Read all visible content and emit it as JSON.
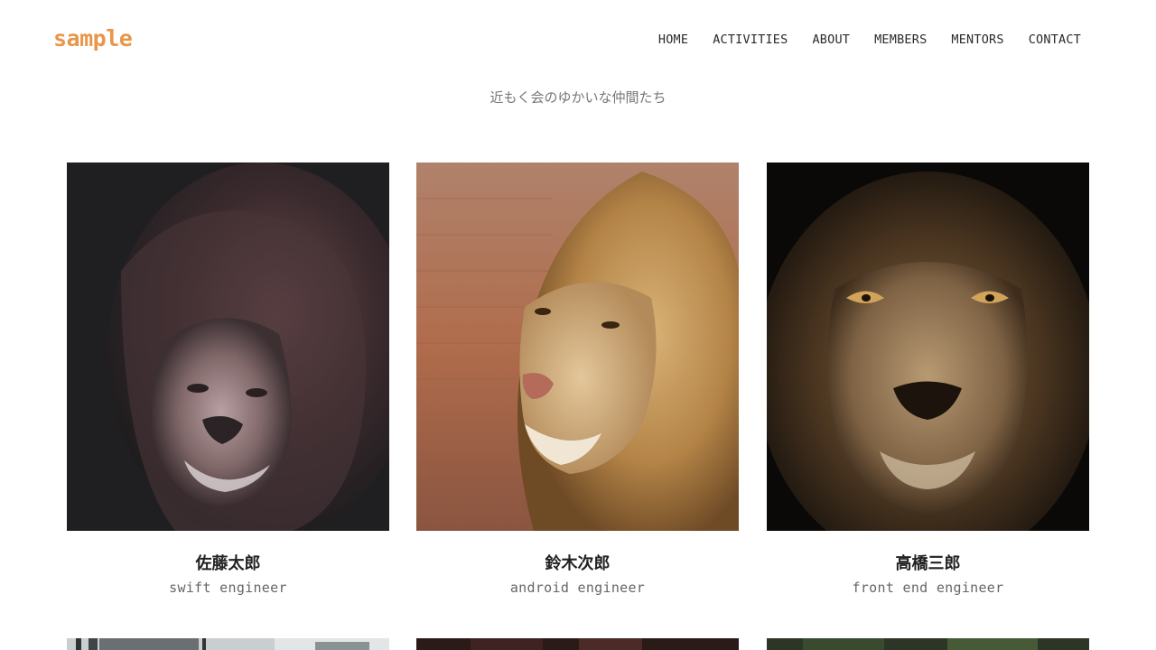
{
  "header": {
    "logo": "sample",
    "nav": [
      "HOME",
      "ACTIVITIES",
      "ABOUT",
      "MEMBERS",
      "MENTORS",
      "CONTACT"
    ]
  },
  "tagline": "近もく会のゆかいな仲間たち",
  "members": [
    {
      "name": "佐藤太郎",
      "role": "swift engineer"
    },
    {
      "name": "鈴木次郎",
      "role": "android engineer"
    },
    {
      "name": "高橋三郎",
      "role": "front end engineer"
    }
  ],
  "colors": {
    "accent": "#e8974a",
    "text": "#2a2a2a",
    "muted": "#666666"
  }
}
